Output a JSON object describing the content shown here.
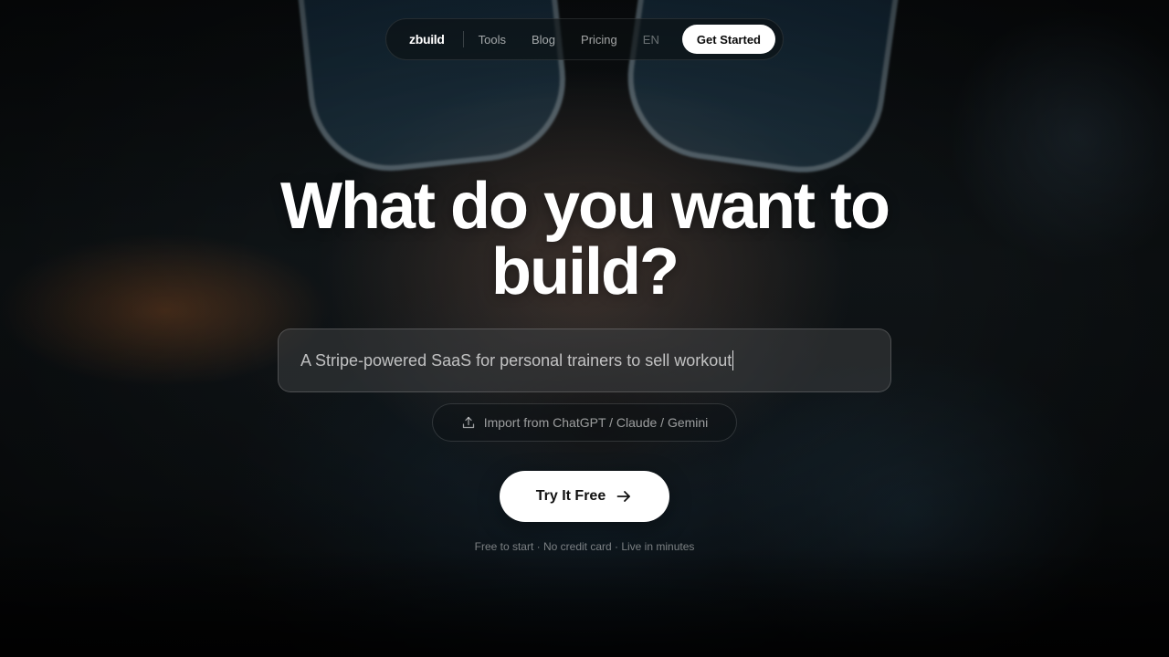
{
  "nav": {
    "brand": "zbuild",
    "links": [
      "Tools",
      "Blog",
      "Pricing"
    ],
    "language": "EN",
    "cta": "Get Started"
  },
  "hero": {
    "title_line1": "What do you want to",
    "title_line2": "build?",
    "prompt_value": "A Stripe-powered SaaS for personal trainers to sell workout",
    "import_label": "Import from ChatGPT / Claude / Gemini",
    "import_icon": "upload-icon",
    "try_label": "Try It Free",
    "try_icon": "arrow-right-icon",
    "footnote": "Free to start · No credit card · Live in minutes"
  },
  "colors": {
    "primary_button_bg": "#ffffff",
    "primary_button_text": "#111111",
    "page_background": "#0b0e10"
  }
}
